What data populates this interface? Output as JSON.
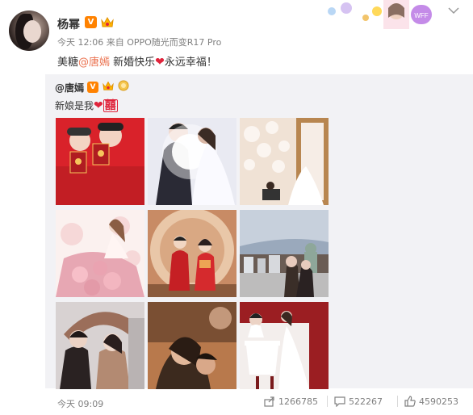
{
  "post": {
    "author": "杨幂",
    "vip_badge": "V",
    "time": "今天 12:06",
    "source": "来自 OPPO随光而变R17 Pro",
    "text_before": "美糖",
    "mention": "@唐嫣",
    "text_middle": " 新婚快乐",
    "text_after": "永远幸福！"
  },
  "banner": {
    "label": "WFF"
  },
  "repost": {
    "author": "@唐嫣",
    "vip_badge": "V",
    "text": "新娘是我",
    "xi": "囍",
    "images": [
      {
        "name": "couple-red-passport",
        "palette": [
          "#d9222a",
          "#c21e24",
          "#f3d4c3"
        ]
      },
      {
        "name": "couple-bright-light",
        "palette": [
          "#e9eaf2",
          "#2a2a35",
          "#ffffff"
        ]
      },
      {
        "name": "balloon-room",
        "palette": [
          "#f0e2d5",
          "#b88650",
          "#f6ede6"
        ]
      },
      {
        "name": "flower-dress",
        "palette": [
          "#f6d8d8",
          "#e7a7b3",
          "#fbf1ef"
        ]
      },
      {
        "name": "traditional-wedding",
        "palette": [
          "#c88b65",
          "#c51f24",
          "#e9c7a8"
        ]
      },
      {
        "name": "city-rooftop",
        "palette": [
          "#9aa9bc",
          "#6a5c54",
          "#dfe3e8"
        ]
      },
      {
        "name": "couple-hat",
        "palette": [
          "#d8d2d2",
          "#2a2222",
          "#9b6e5a"
        ]
      },
      {
        "name": "couple-warm-light",
        "palette": [
          "#b8794c",
          "#3c2a1e",
          "#e2b89a"
        ]
      },
      {
        "name": "couple-dinner",
        "palette": [
          "#f3eeec",
          "#9b1e22",
          "#ffffff"
        ]
      }
    ]
  },
  "footer": {
    "time": "今天 09:09",
    "reposts": "1266785",
    "comments": "522267",
    "likes": "4590253"
  },
  "colors": {
    "mention": "#eb7350",
    "muted": "#808080",
    "repost_bg": "#f2f2f5",
    "heart": "#e0243b",
    "vip": "#ff8200"
  }
}
